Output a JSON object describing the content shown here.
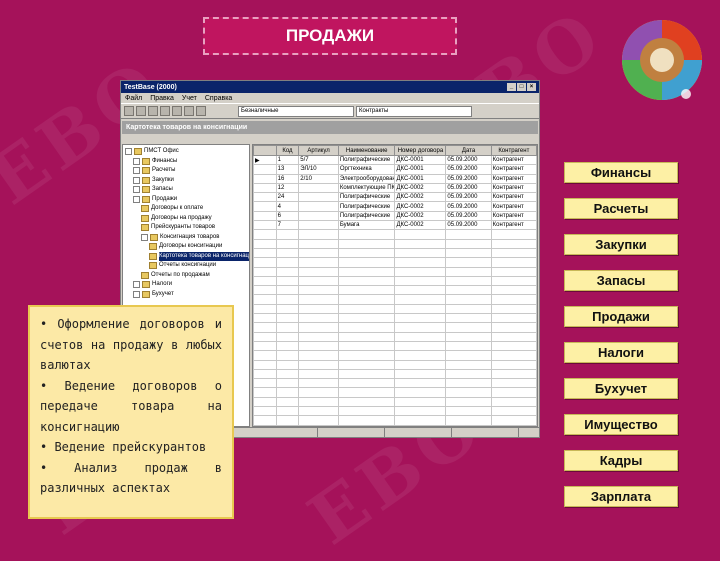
{
  "slide": {
    "title": "ПРОДАЖИ"
  },
  "colors": {
    "background": "#a5125a",
    "menu_button": "#fdf0a5",
    "note_box": "#fce9a6"
  },
  "app_window": {
    "title": "TestBase (2000)",
    "menu": [
      "Файл",
      "Правка",
      "Учет",
      "Справка"
    ],
    "toolbar_combo_1": "Безналичные",
    "toolbar_combo_2": "Контракты",
    "subtitle": "Картотека товаров на консигнации",
    "tree_items": [
      "ПМСТ Офис",
      "Финансы",
      "Расчеты",
      "Закупки",
      "Запасы",
      "Продажи",
      "Договоры к оплате",
      "Договоры на продажу",
      "Прейскуранты товаров",
      "Консигнация товаров",
      "Договоры консигнации",
      "Картотека товаров на консигнации",
      "Отчеты консигнации",
      "Отчеты по продажам",
      "Налоги",
      "Бухучет"
    ],
    "grid_columns": [
      "",
      "Код",
      "Артикул",
      "Наименование",
      "Номер договора",
      "Дата",
      "Контрагент"
    ],
    "grid_rows": [
      [
        "▶",
        "1",
        "5/7",
        "Полиграфические",
        "ДКС-0001",
        "05.09.2000",
        "Контрагент"
      ],
      [
        "",
        "13",
        "ЭЛ/10",
        "Оргтехника",
        "ДКС-0001",
        "05.09.2000",
        "Контрагент"
      ],
      [
        "",
        "16",
        "2/10",
        "Электрооборудование",
        "ДКС-0001",
        "05.09.2000",
        "Контрагент"
      ],
      [
        "",
        "12",
        "",
        "Комплектующие ПК",
        "ДКС-0002",
        "05.09.2000",
        "Контрагент"
      ],
      [
        "",
        "24",
        "",
        "Полиграфические",
        "ДКС-0002",
        "05.09.2000",
        "Контрагент"
      ],
      [
        "",
        "4",
        "",
        "Полиграфические",
        "ДКС-0002",
        "05.09.2000",
        "Контрагент"
      ],
      [
        "",
        "6",
        "",
        "Полиграфические",
        "ДКС-0002",
        "05.09.2000",
        "Контрагент"
      ],
      [
        "",
        "7",
        "",
        "Бумага",
        "ДКС-0002",
        "05.09.2000",
        "Контрагент"
      ]
    ],
    "status": [
      "Готово",
      "",
      "",
      ""
    ]
  },
  "notes": [
    "• Оформление договоров и счетов на продажу в любых валютах",
    "• Ведение договоров о передаче товара на консигнацию",
    "• Ведение прейскурантов",
    "• Анализ продаж в различных аспектах"
  ],
  "menu": [
    "Финансы",
    "Расчеты",
    "Закупки",
    "Запасы",
    "Продажи",
    "Налоги",
    "Бухучет",
    "Имущество",
    "Кадры",
    "Зарплата"
  ]
}
